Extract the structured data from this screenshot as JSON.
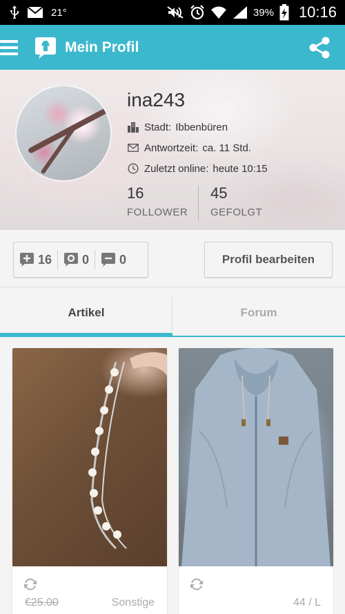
{
  "status_bar": {
    "temperature": "21°",
    "battery": "39%",
    "time": "10:16"
  },
  "app_bar": {
    "title": "Mein Profil"
  },
  "profile": {
    "username": "ina243",
    "city_label": "Stadt:",
    "city_value": "Ibbenbüren",
    "response_label": "Antwortzeit:",
    "response_value": "ca. 11 Std.",
    "online_label": "Zuletzt online:",
    "online_value": "heute 10:15",
    "followers_count": "16",
    "followers_label": "FOLLOWER",
    "following_count": "45",
    "following_label": "GEFOLGT"
  },
  "ratings": {
    "positive": "16",
    "neutral": "0",
    "negative": "0"
  },
  "edit_button": "Profil bearbeiten",
  "tabs": [
    {
      "label": "Artikel",
      "active": true
    },
    {
      "label": "Forum",
      "active": false
    }
  ],
  "items": [
    {
      "price": "€25.00",
      "meta": "Sonstige"
    },
    {
      "price": "",
      "meta": "44 / L"
    }
  ],
  "colors": {
    "accent": "#3bb8cd"
  }
}
